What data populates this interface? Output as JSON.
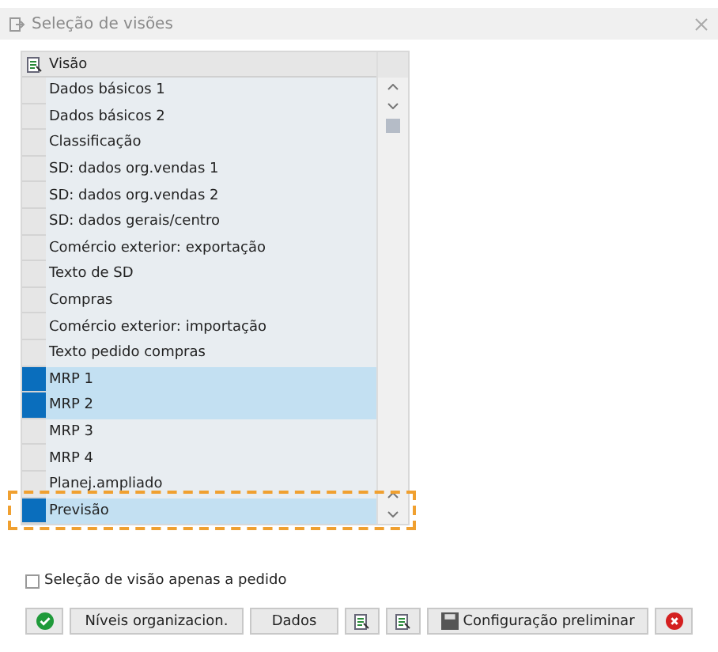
{
  "window": {
    "title": "Seleção de visões"
  },
  "table": {
    "column": "Visão",
    "rows": [
      {
        "label": "Dados básicos 1",
        "selected": false,
        "highlighted": false
      },
      {
        "label": "Dados básicos 2",
        "selected": false,
        "highlighted": false
      },
      {
        "label": "Classificação",
        "selected": false,
        "highlighted": false
      },
      {
        "label": "SD: dados org.vendas 1",
        "selected": false,
        "highlighted": false
      },
      {
        "label": "SD: dados org.vendas 2",
        "selected": false,
        "highlighted": false
      },
      {
        "label": "SD: dados gerais/centro",
        "selected": false,
        "highlighted": false
      },
      {
        "label": "Comércio exterior: exportação",
        "selected": false,
        "highlighted": false
      },
      {
        "label": "Texto de SD",
        "selected": false,
        "highlighted": false
      },
      {
        "label": "Compras",
        "selected": false,
        "highlighted": false
      },
      {
        "label": "Comércio exterior: importação",
        "selected": false,
        "highlighted": false
      },
      {
        "label": "Texto pedido compras",
        "selected": false,
        "highlighted": false
      },
      {
        "label": "MRP 1",
        "selected": true,
        "highlighted": false
      },
      {
        "label": "MRP 2",
        "selected": true,
        "highlighted": false
      },
      {
        "label": "MRP 3",
        "selected": false,
        "highlighted": false
      },
      {
        "label": "MRP 4",
        "selected": false,
        "highlighted": false
      },
      {
        "label": "Planej.ampliado",
        "selected": false,
        "highlighted": false
      },
      {
        "label": "Previsão",
        "selected": true,
        "highlighted": true
      }
    ]
  },
  "option": {
    "label": "Seleção de visão apenas a pedido",
    "checked": false
  },
  "buttons": [
    {
      "kind": "ok"
    },
    {
      "kind": "text",
      "label": "Níveis organizacion."
    },
    {
      "kind": "text",
      "label": "Dados"
    },
    {
      "kind": "select-all"
    },
    {
      "kind": "deselect-all"
    },
    {
      "kind": "save",
      "label": "Configuração preliminar"
    },
    {
      "kind": "cancel"
    }
  ]
}
